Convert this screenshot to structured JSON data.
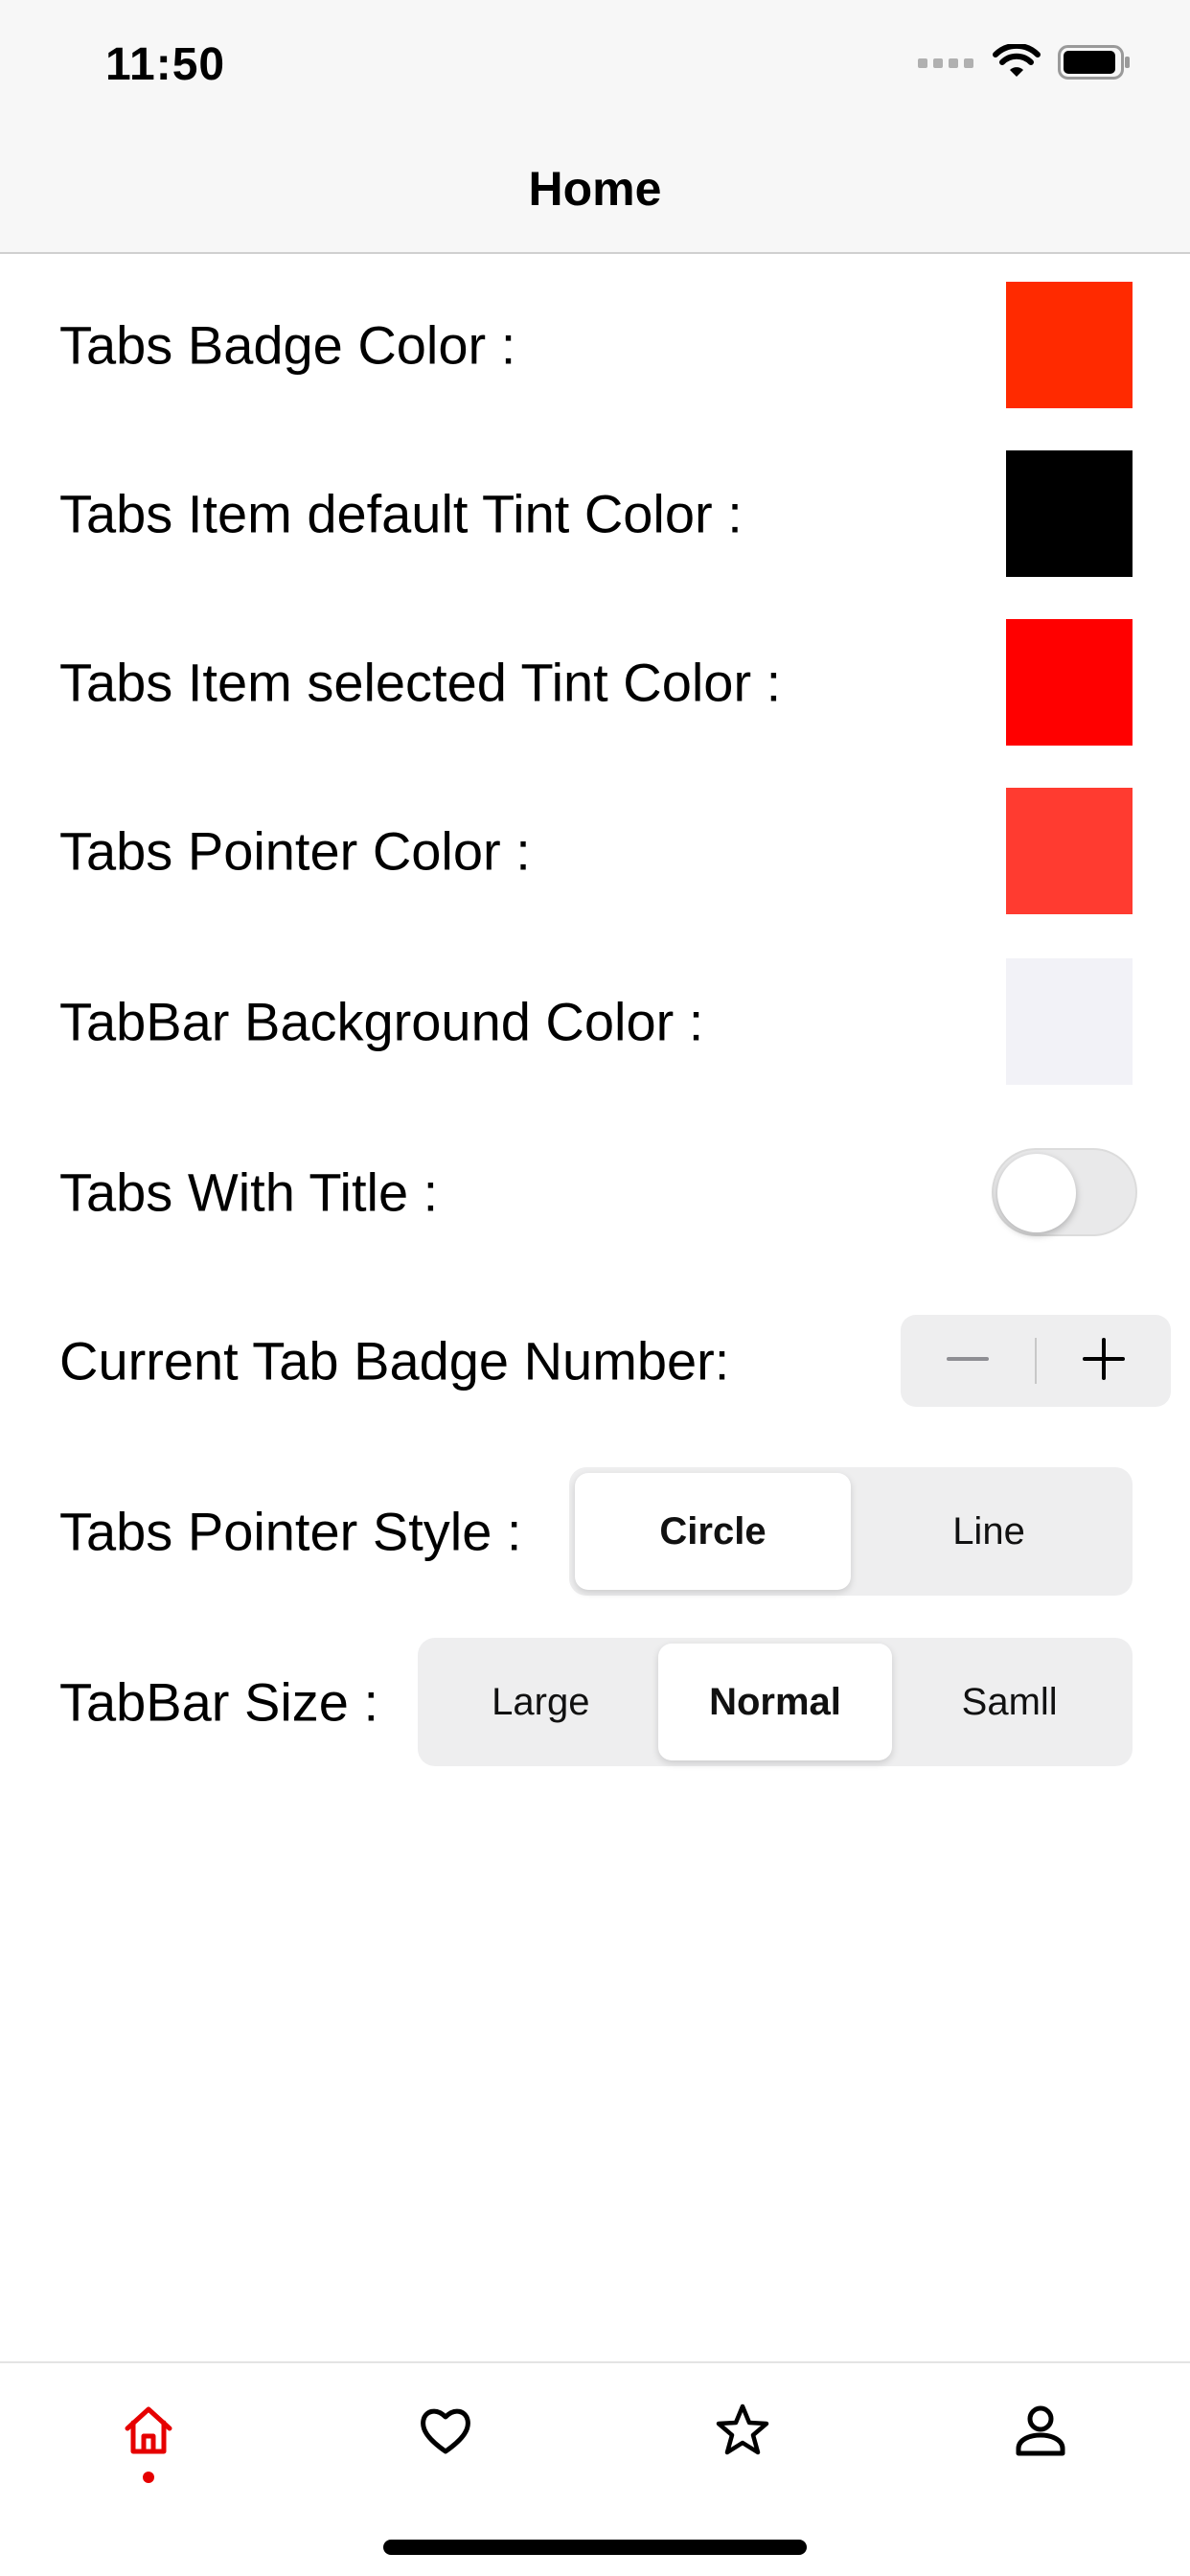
{
  "status_bar": {
    "time": "11:50"
  },
  "nav": {
    "title": "Home"
  },
  "settings": {
    "badge_color": {
      "label": "Tabs Badge Color :",
      "color": "#ff2a00"
    },
    "default_tint": {
      "label": "Tabs Item default Tint Color :",
      "color": "#000000"
    },
    "selected_tint": {
      "label": "Tabs Item selected Tint Color :",
      "color": "#ff0000"
    },
    "pointer_color": {
      "label": "Tabs Pointer Color :",
      "color": "#ff3b30"
    },
    "tabbar_bg": {
      "label": "TabBar Background Color :",
      "color": "#f2f2f7"
    },
    "with_title": {
      "label": "Tabs With Title :",
      "enabled": false
    },
    "badge_number": {
      "label": "Current Tab Badge Number:",
      "minus": "−",
      "plus": "+"
    },
    "pointer_style": {
      "label": "Tabs Pointer Style :",
      "options": [
        "Circle",
        "Line"
      ],
      "selected": "Circle"
    },
    "tabbar_size": {
      "label": "TabBar Size :",
      "options": [
        "Large",
        "Normal",
        "Samll"
      ],
      "selected": "Normal"
    }
  },
  "tabbar": {
    "tabs": [
      {
        "icon": "home-icon",
        "selected": true
      },
      {
        "icon": "heart-icon",
        "selected": false
      },
      {
        "icon": "star-icon",
        "selected": false
      },
      {
        "icon": "person-icon",
        "selected": false
      }
    ],
    "selected_color": "#e60000",
    "default_color": "#000000"
  }
}
